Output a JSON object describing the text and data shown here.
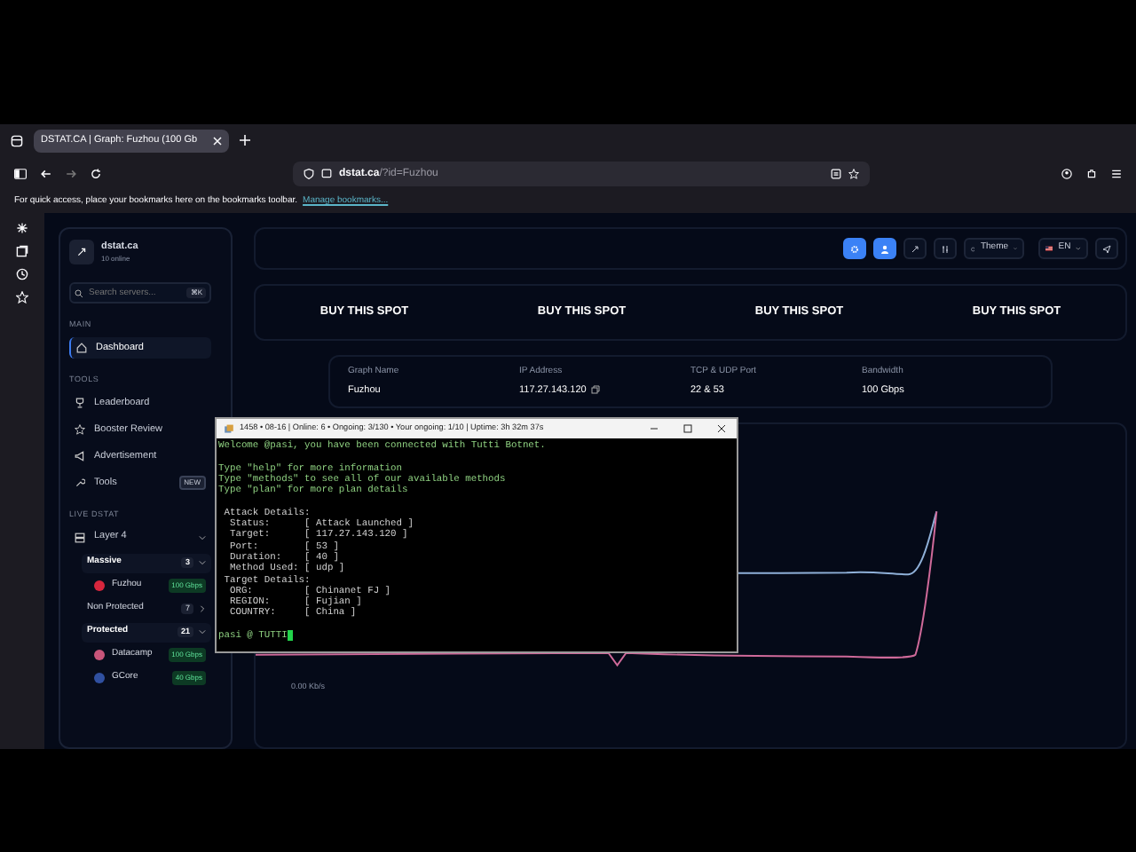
{
  "browser": {
    "tab_title": "DSTAT.CA | Graph: Fuzhou (100 Gb",
    "url_host": "dstat.ca",
    "url_path": "/?id=Fuzhou",
    "bookmarks_hint": "For quick access, place your bookmarks here on the bookmarks toolbar.",
    "bookmarks_link": "Manage bookmarks..."
  },
  "sidebar": {
    "brand": "dstat.ca",
    "online": "10 online",
    "search": {
      "placeholder": "Search servers...",
      "shortcut": "⌘K"
    },
    "sections": [
      {
        "title": "MAIN",
        "items": [
          {
            "label": "Dashboard",
            "selected": true
          }
        ]
      },
      {
        "title": "TOOLS",
        "items": [
          {
            "label": "Leaderboard",
            "selected": false
          },
          {
            "label": "Booster Review",
            "selected": false
          },
          {
            "label": "Advertisement",
            "selected": false
          },
          {
            "label": "Tools",
            "selected": false,
            "badge": "NEW"
          }
        ]
      },
      {
        "title": "LIVE DSTAT",
        "items": [
          {
            "label": "Layer 4",
            "selected": false,
            "expanded": true
          }
        ]
      }
    ],
    "groups": [
      {
        "label": "Massive",
        "count": "3",
        "expanded": true,
        "servers": [
          {
            "name": "Fuzhou",
            "bandwidth": "100 Gbps",
            "color": "#d7263d"
          }
        ]
      },
      {
        "label": "Non Protected",
        "count": "7",
        "expanded": false
      },
      {
        "label": "Protected",
        "count": "21",
        "expanded": true,
        "servers": [
          {
            "name": "Datacamp",
            "bandwidth": "100 Gbps",
            "color": "#c8557a"
          },
          {
            "name": "GCore",
            "bandwidth": "40 Gbps",
            "color": "#3050a0"
          }
        ]
      }
    ]
  },
  "topbar": {
    "theme": "Theme",
    "language": "EN"
  },
  "ads": [
    "BUY THIS SPOT",
    "BUY THIS SPOT",
    "BUY THIS SPOT",
    "BUY THIS SPOT"
  ],
  "info": [
    {
      "label": "Graph Name",
      "value": "Fuzhou"
    },
    {
      "label": "IP Address",
      "value": "117.27.143.120",
      "copy": true
    },
    {
      "label": "TCP & UDP Port",
      "value": "22 & 53"
    },
    {
      "label": "Bandwidth",
      "value": "100 Gbps"
    }
  ],
  "chart": {
    "axis_label": "0.00 Kb/s"
  },
  "terminal": {
    "title": "1458 • 08-16 | Online: 6 • Ongoing: 3/130 • Your ongoing: 1/10 | Uptime: 3h 32m 37s",
    "lines": [
      {
        "kind": "notice",
        "text": "Welcome @pasi, you have been connected with Tutti Botnet."
      },
      {
        "kind": "blank"
      },
      {
        "kind": "notice",
        "text": "Type \"help\" for more information"
      },
      {
        "kind": "notice",
        "text": "Type \"methods\" to see all of our available methods"
      },
      {
        "kind": "notice",
        "text": "Type \"plan\" for more plan details"
      },
      {
        "kind": "blank"
      },
      {
        "kind": "detail",
        "text": " Attack Details:"
      },
      {
        "kind": "detail",
        "text": "  Status:      [ Attack Launched ]"
      },
      {
        "kind": "detail",
        "text": "  Target:      [ 117.27.143.120 ]"
      },
      {
        "kind": "detail",
        "text": "  Port:        [ 53 ]"
      },
      {
        "kind": "detail",
        "text": "  Duration:    [ 40 ]"
      },
      {
        "kind": "detail",
        "text": "  Method Used: [ udp ]"
      },
      {
        "kind": "detail",
        "text": " Target Details:"
      },
      {
        "kind": "detail",
        "text": "  ORG:         [ Chinanet FJ ]"
      },
      {
        "kind": "detail",
        "text": "  REGION:      [ Fujian ]"
      },
      {
        "kind": "detail",
        "text": "  COUNTRY:     [ China ]"
      },
      {
        "kind": "blank"
      },
      {
        "kind": "prompt",
        "text": "pasi @ TUTTI"
      }
    ]
  }
}
